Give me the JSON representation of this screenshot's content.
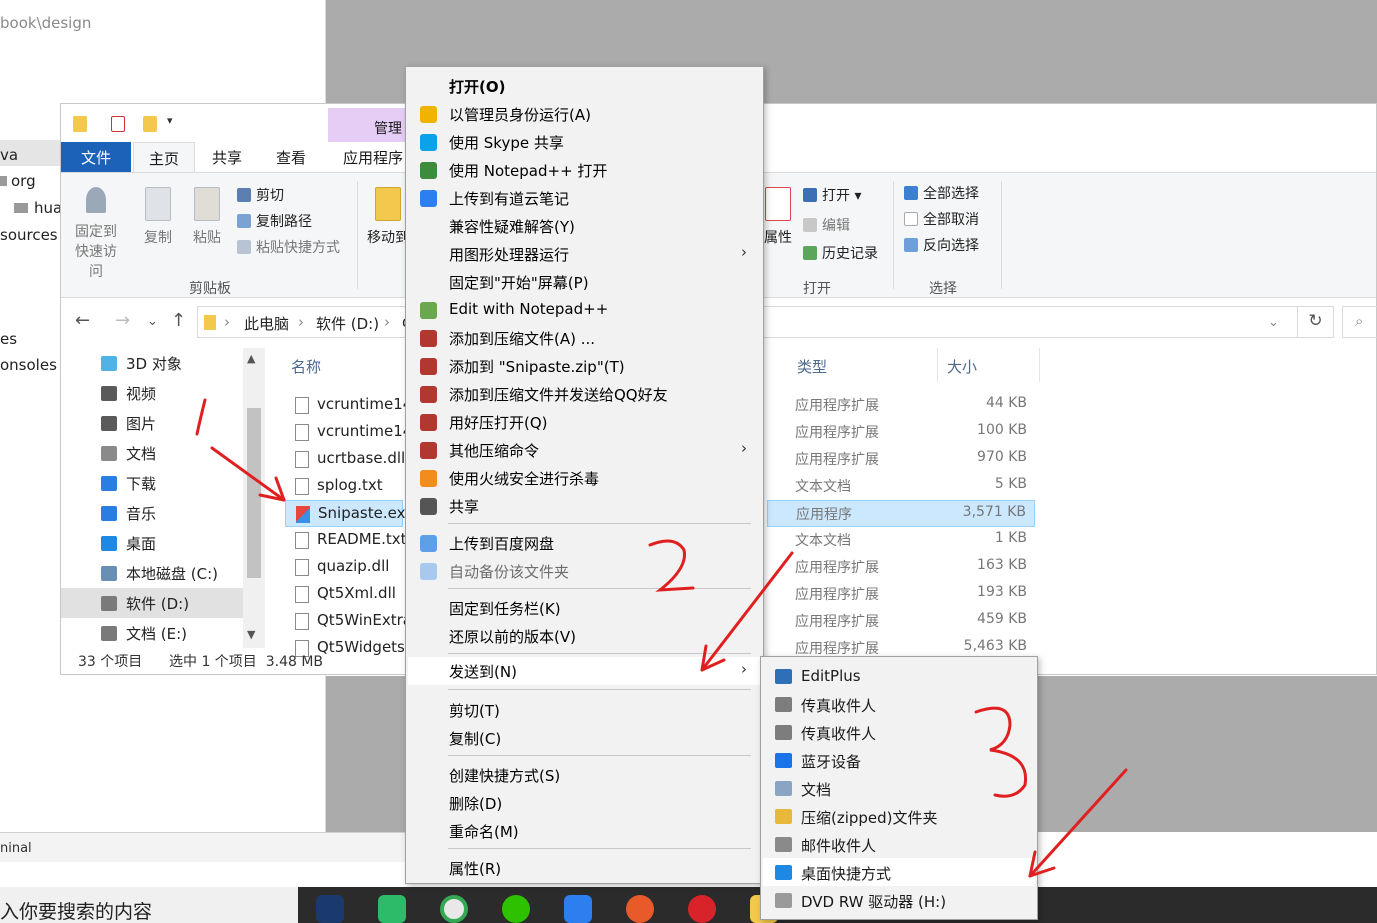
{
  "background_window": {
    "path_fragment": "book\\design",
    "tree": [
      "va",
      "org",
      "hua",
      "sources",
      "es",
      "onsoles"
    ],
    "terminal_label": "ninal",
    "search_placeholder": "入你要搜索的内容"
  },
  "explorer": {
    "manage_tab": "管理",
    "ribbon_tabs": [
      "文件",
      "主页",
      "共享",
      "查看",
      "应用程序"
    ],
    "ribbon": {
      "pin": "固定到\n快速访问",
      "pin_line1": "固定到",
      "pin_line2": "快速访问",
      "copy": "复制",
      "paste": "粘贴",
      "cut": "剪切",
      "copy_path": "复制路径",
      "paste_shortcut": "粘贴快捷方式",
      "clipboard_group": "剪贴板",
      "move_to": "移动到",
      "properties_partial": "属性",
      "open": "打开",
      "edit": "编辑",
      "history": "历史记录",
      "open_group": "打开",
      "select_all": "全部选择",
      "select_none": "全部取消",
      "invert_selection": "反向选择",
      "select_group": "选择"
    },
    "breadcrumb": [
      "此电脑",
      "软件 (D:)",
      "d"
    ],
    "nav_pane": [
      {
        "label": "3D 对象",
        "color": "#4fb3e8"
      },
      {
        "label": "视频",
        "color": "#5a5a5a"
      },
      {
        "label": "图片",
        "color": "#5a5a5a"
      },
      {
        "label": "文档",
        "color": "#8a8a8a"
      },
      {
        "label": "下载",
        "color": "#2a7de1"
      },
      {
        "label": "音乐",
        "color": "#2a7de1"
      },
      {
        "label": "桌面",
        "color": "#1e88e5"
      },
      {
        "label": "本地磁盘 (C:)",
        "color": "#6a8fb5"
      },
      {
        "label": "软件 (D:)",
        "color": "#7a7a7a"
      },
      {
        "label": "文档 (E:)",
        "color": "#7a7a7a"
      }
    ],
    "columns": {
      "name": "名称",
      "type": "类型",
      "size": "大小"
    },
    "files": [
      {
        "name": "vcruntime14",
        "type": "应用程序扩展",
        "size": "44 KB"
      },
      {
        "name": "vcruntime14",
        "type": "应用程序扩展",
        "size": "100 KB"
      },
      {
        "name": "ucrtbase.dll",
        "type": "应用程序扩展",
        "size": "970 KB"
      },
      {
        "name": "splog.txt",
        "type": "文本文档",
        "size": "5 KB"
      },
      {
        "name": "Snipaste.exe",
        "type": "应用程序",
        "size": "3,571 KB"
      },
      {
        "name": "README.txt",
        "type": "文本文档",
        "size": "1 KB"
      },
      {
        "name": "quazip.dll",
        "type": "应用程序扩展",
        "size": "163 KB"
      },
      {
        "name": "Qt5Xml.dll",
        "type": "应用程序扩展",
        "size": "193 KB"
      },
      {
        "name": "Qt5WinExtra",
        "type": "应用程序扩展",
        "size": "459 KB"
      },
      {
        "name": "Qt5Widgets",
        "type": "应用程序扩展",
        "size": "5,463 KB"
      }
    ],
    "status": {
      "count": "33 个项目",
      "selected": "选中 1 个项目  3.48 MB"
    }
  },
  "context_menu": [
    {
      "label": "打开(O)",
      "bold": true
    },
    {
      "label": "以管理员身份运行(A)",
      "icon": "shield-icon",
      "color": "#f0b400"
    },
    {
      "label": "使用 Skype 共享",
      "icon": "skype-icon",
      "color": "#0aa2e8"
    },
    {
      "label": "使用 Notepad++ 打开",
      "icon": "notepadpp-icon",
      "color": "#3c8c3c"
    },
    {
      "label": "上传到有道云笔记",
      "icon": "youdao-icon",
      "color": "#2d7ff0"
    },
    {
      "label": "兼容性疑难解答(Y)"
    },
    {
      "label": "用图形处理器运行",
      "submenu": true
    },
    {
      "label": "固定到\"开始\"屏幕(P)"
    },
    {
      "label": "Edit with Notepad++",
      "icon": "notepadpp-icon",
      "color": "#6aa84f"
    },
    {
      "label": "添加到压缩文件(A) ...",
      "icon": "winrar-icon",
      "color": "#b0382f"
    },
    {
      "label": "添加到 \"Snipaste.zip\"(T)",
      "icon": "winrar-icon",
      "color": "#b0382f"
    },
    {
      "label": "添加到压缩文件并发送给QQ好友",
      "icon": "winrar-icon",
      "color": "#b0382f"
    },
    {
      "label": "用好压打开(Q)",
      "icon": "winrar-icon",
      "color": "#b0382f"
    },
    {
      "label": "其他压缩命令",
      "icon": "winrar-icon",
      "color": "#b0382f",
      "submenu": true
    },
    {
      "label": "使用火绒安全进行杀毒",
      "icon": "huorong-icon",
      "color": "#f28c1c"
    },
    {
      "label": "共享",
      "icon": "share-icon",
      "color": "#555555"
    },
    {
      "label": "上传到百度网盘",
      "icon": "baidu-cloud-icon",
      "color": "#5ea0e8"
    },
    {
      "label": "自动备份该文件夹",
      "icon": "baidu-cloud-icon",
      "color": "#a9c8ee",
      "disabled": true
    },
    {
      "label": "固定到任务栏(K)"
    },
    {
      "label": "还原以前的版本(V)"
    },
    {
      "label": "发送到(N)",
      "submenu": true,
      "highlight": true
    },
    {
      "label": "剪切(T)"
    },
    {
      "label": "复制(C)"
    },
    {
      "label": "创建快捷方式(S)"
    },
    {
      "label": "删除(D)"
    },
    {
      "label": "重命名(M)"
    },
    {
      "label": "属性(R)"
    }
  ],
  "send_to_menu": [
    {
      "label": "EditPlus",
      "icon": "editplus-icon",
      "color": "#2f6fb8"
    },
    {
      "label": "传真收件人",
      "icon": "fax-icon",
      "color": "#7d7d7d"
    },
    {
      "label": "传真收件人",
      "icon": "fax-icon",
      "color": "#7d7d7d"
    },
    {
      "label": "蓝牙设备",
      "icon": "bluetooth-icon",
      "color": "#1a73e8"
    },
    {
      "label": "文档",
      "icon": "document-icon",
      "color": "#8aa4c4"
    },
    {
      "label": "压缩(zipped)文件夹",
      "icon": "zip-folder-icon",
      "color": "#e8b83a"
    },
    {
      "label": "邮件收件人",
      "icon": "mail-icon",
      "color": "#8a8a8a"
    },
    {
      "label": "桌面快捷方式",
      "icon": "desktop-icon",
      "color": "#1e88e5",
      "highlight": true
    },
    {
      "label": "DVD RW 驱动器 (H:)",
      "icon": "dvd-drive-icon",
      "color": "#9a9a9a"
    }
  ],
  "annotations": [
    "1",
    "2",
    "3"
  ],
  "colors": {
    "annotation": "#e02020",
    "selection": "#cce8ff",
    "file_tab": "#1c62b9",
    "manage_tab": "#e6cdf6"
  }
}
